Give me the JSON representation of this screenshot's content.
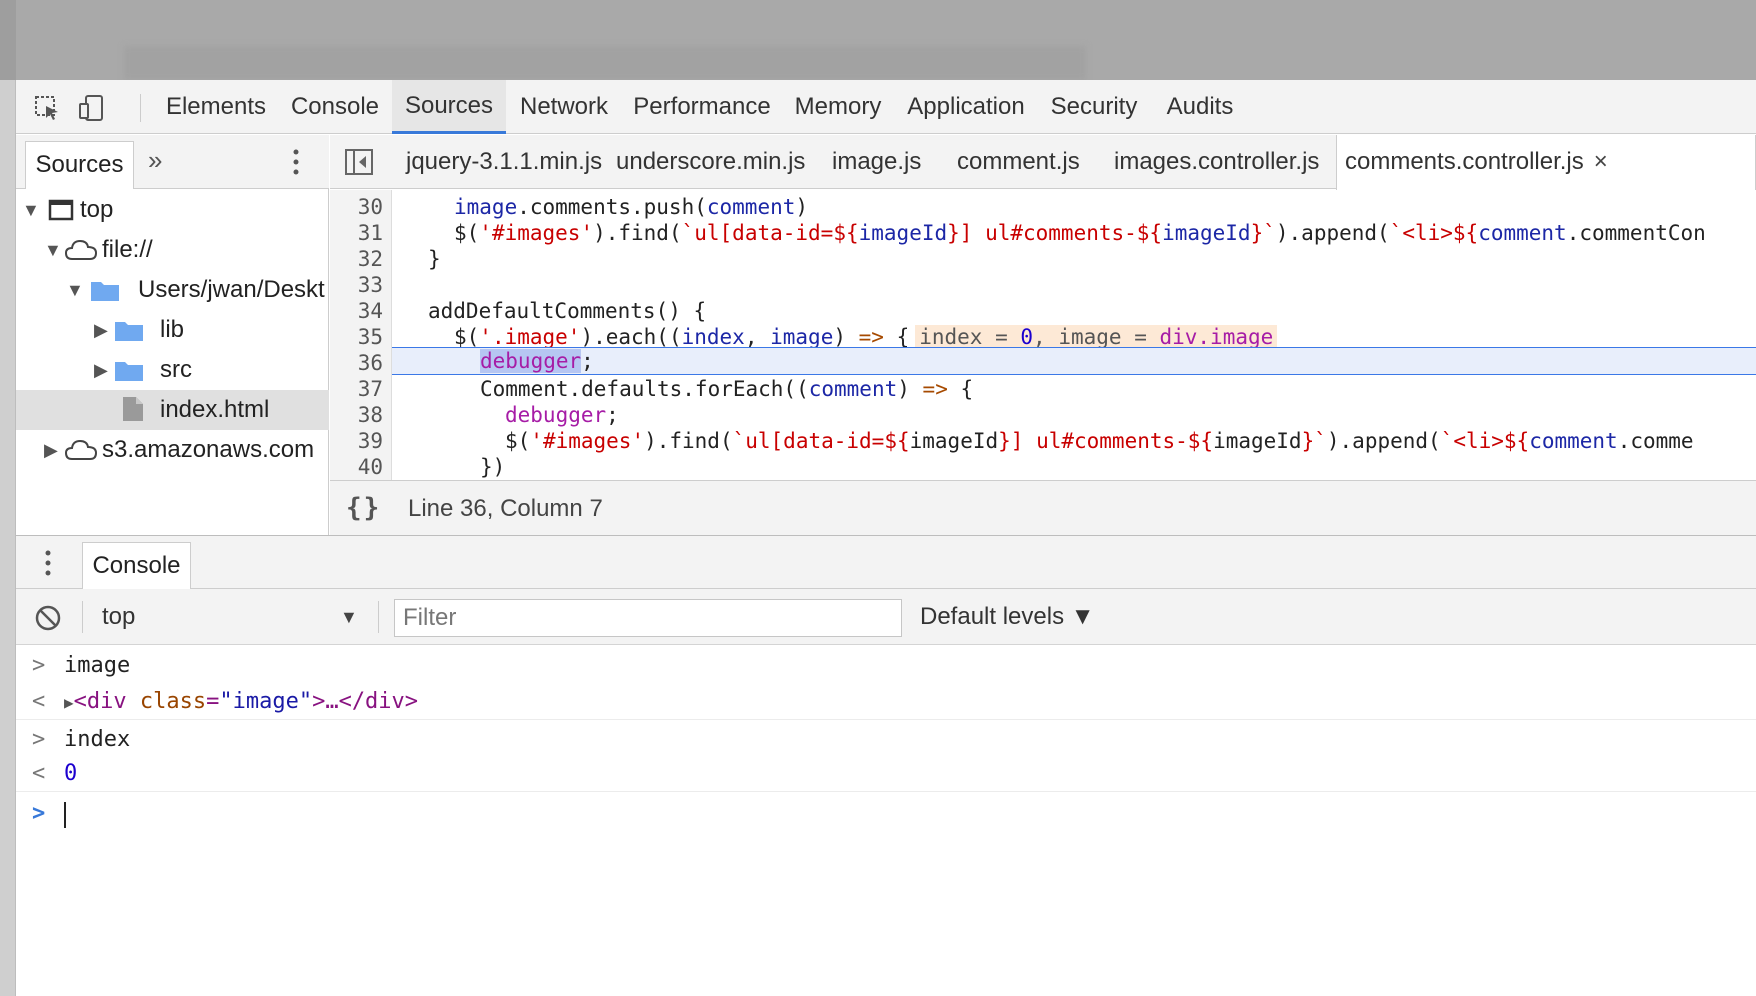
{
  "devtools": {
    "main_tabs": [
      "Elements",
      "Console",
      "Sources",
      "Network",
      "Performance",
      "Memory",
      "Application",
      "Security",
      "Audits"
    ],
    "active_main_tab": "Sources",
    "icons": {
      "inspect": "inspect-element-icon",
      "device": "device-toolbar-icon"
    }
  },
  "navigator": {
    "tab_label": "Sources",
    "more_label": "»",
    "tree": [
      {
        "label": "top",
        "icon": "frame-icon",
        "expanded": true,
        "depth": 0
      },
      {
        "label": "file://",
        "icon": "cloud-icon",
        "expanded": true,
        "depth": 1
      },
      {
        "label": "Users/jwan/Deskt",
        "icon": "folder-icon",
        "expanded": true,
        "depth": 2
      },
      {
        "label": "lib",
        "icon": "folder-icon",
        "expanded": false,
        "depth": 3
      },
      {
        "label": "src",
        "icon": "folder-icon",
        "expanded": false,
        "depth": 3
      },
      {
        "label": "index.html",
        "icon": "file-icon",
        "depth": 3,
        "selected": true
      },
      {
        "label": "s3.amazonaws.com",
        "icon": "cloud-icon",
        "expanded": false,
        "depth": 1
      }
    ]
  },
  "editor": {
    "file_tabs": [
      "jquery-3.1.1.min.js",
      "underscore.min.js",
      "image.js",
      "comment.js",
      "images.controller.js",
      "comments.controller.js"
    ],
    "active_file": "comments.controller.js",
    "close_glyph": "×",
    "line_numbers": [
      "30",
      "31",
      "32",
      "33",
      "34",
      "35",
      "36",
      "37",
      "38",
      "39",
      "40"
    ],
    "execution_line": "36",
    "code": {
      "l30": {
        "a": "image",
        "b": ".comments.push(",
        "c": "comment",
        "d": ")"
      },
      "l31": {
        "a": "$(",
        "b": "'#images'",
        "c": ").find(",
        "d": "`ul[data-id=${",
        "e": "imageId",
        "f": "}] ul#comments-${",
        "g": "imageId",
        "h": "}`",
        "i": ").append(",
        "j": "`<li>${",
        "k": "comment",
        "l": ".commentCon"
      },
      "l32": "}",
      "l34": "addDefaultComments() {",
      "l35": {
        "a": "$(",
        "b": "'.image'",
        "c": ").each((",
        "d": "index",
        "e": ", ",
        "f": "image",
        "g": ") ",
        "h": "=>",
        "i": " {"
      },
      "l35_inline": {
        "a": "index = ",
        "b": "0",
        "c": ", image = ",
        "d": "div.image"
      },
      "l36": {
        "a": "debugger",
        "b": ";"
      },
      "l37": {
        "a": "Comment.defaults.forEach((",
        "b": "comment",
        "c": ") ",
        "d": "=>",
        "e": " {"
      },
      "l38": {
        "a": "debugger",
        "b": ";"
      },
      "l39": {
        "a": "$(",
        "b": "'#images'",
        "c": ").find(",
        "d": "`ul[data-id=${",
        "e": "imageId",
        "f": "}] ul#comments-${",
        "g": "imageId",
        "h": "}`",
        "i": ").append(",
        "j": "`<li>${",
        "k": "comment",
        "l": ".comme"
      },
      "l40": "})"
    },
    "status": {
      "pretty_print": "{}",
      "cursor": "Line 36, Column 7"
    }
  },
  "drawer": {
    "tab_label": "Console",
    "context": "top",
    "filter_placeholder": "Filter",
    "levels": "Default levels ▼",
    "entries": [
      {
        "type": "input",
        "prompt": ">",
        "text": "image"
      },
      {
        "type": "output",
        "prompt": "<",
        "tag_open": "<div",
        "attr": "class",
        "attr_val": "\"image\"",
        "tag_rest": ">…</div>"
      },
      {
        "type": "input",
        "prompt": ">",
        "text": "index"
      },
      {
        "type": "output",
        "prompt": "<",
        "text": "0"
      }
    ],
    "active_prompt": ">"
  },
  "colors": {
    "accent": "#3879d9",
    "string": "#c80000",
    "variable": "#1c27a6",
    "keyword": "#a61ca6"
  }
}
